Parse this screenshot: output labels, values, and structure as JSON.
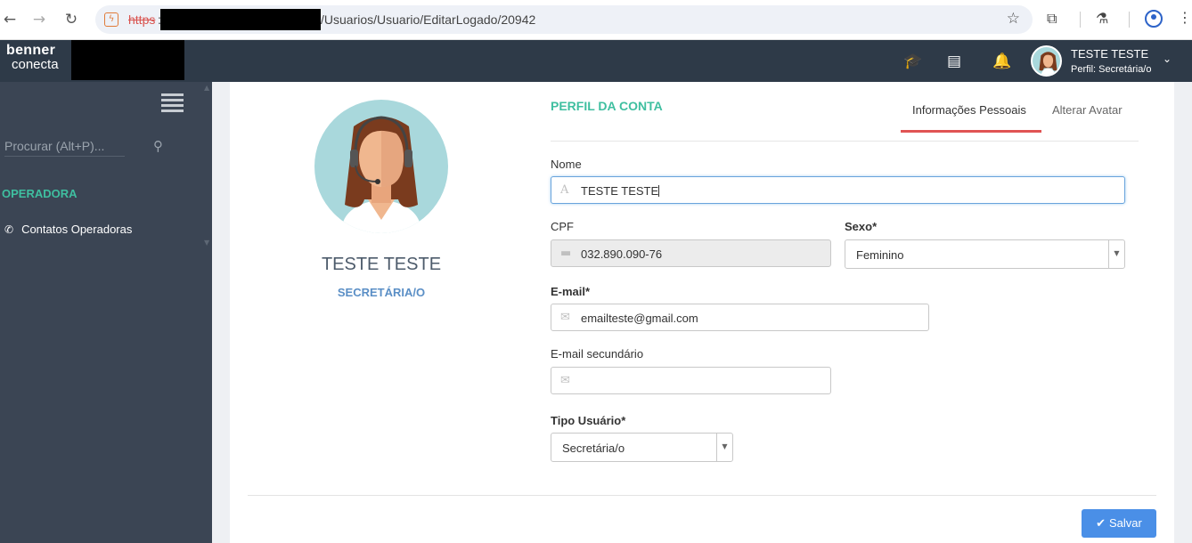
{
  "browser": {
    "url_scheme": "https",
    "url_colon": ":",
    "url_path": "/Usuarios/Usuario/EditarLogado/20942"
  },
  "header": {
    "logo_line1": "benner",
    "logo_line2": "conecta",
    "user_name": "TESTE TESTE",
    "user_profile": "Perfil: Secretária/o"
  },
  "sidebar": {
    "search_placeholder": "Procurar (Alt+P)...",
    "section": "OPERADORA",
    "items": [
      {
        "label": "Contatos Operadoras",
        "icon": "phone-icon"
      }
    ]
  },
  "profile": {
    "name": "TESTE TESTE",
    "role": "SECRETÁRIA/O"
  },
  "form": {
    "section_title": "PERFIL DA CONTA",
    "tabs": [
      "Informações Pessoais",
      "Alterar Avatar"
    ],
    "nome_label": "Nome",
    "nome_value": "TESTE TESTE",
    "cpf_label": "CPF",
    "cpf_value": "032.890.090-76",
    "sexo_label": "Sexo*",
    "sexo_value": "Feminino",
    "email_label": "E-mail*",
    "email_value": "emailteste@gmail.com",
    "email2_label": "E-mail secundário",
    "email2_value": "",
    "tipo_label": "Tipo Usuário*",
    "tipo_value": "Secretária/o",
    "save_label": "Salvar"
  },
  "colors": {
    "accent_green": "#3fbfa0",
    "tab_active": "#e05454",
    "save_button": "#4a8fe7",
    "sidebar_bg": "#3b4554",
    "header_bg": "#2e3a48"
  }
}
